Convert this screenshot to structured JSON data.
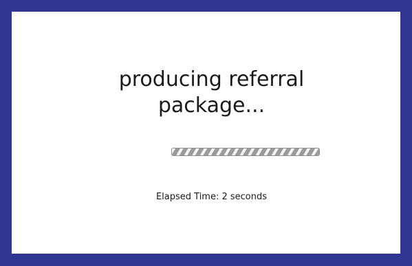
{
  "dialog": {
    "title_line1": "producing referral",
    "title_line2": "package...",
    "elapsed_label": "Elapsed Time: 2 seconds"
  },
  "progress": {
    "fraction": 1.0,
    "style": "indeterminate-striped"
  },
  "colors": {
    "frame_border": "#2e3592",
    "panel_background": "#ffffff",
    "progress_stripe_dark": "#9b9b9b",
    "progress_stripe_light": "#f4f4f4"
  }
}
